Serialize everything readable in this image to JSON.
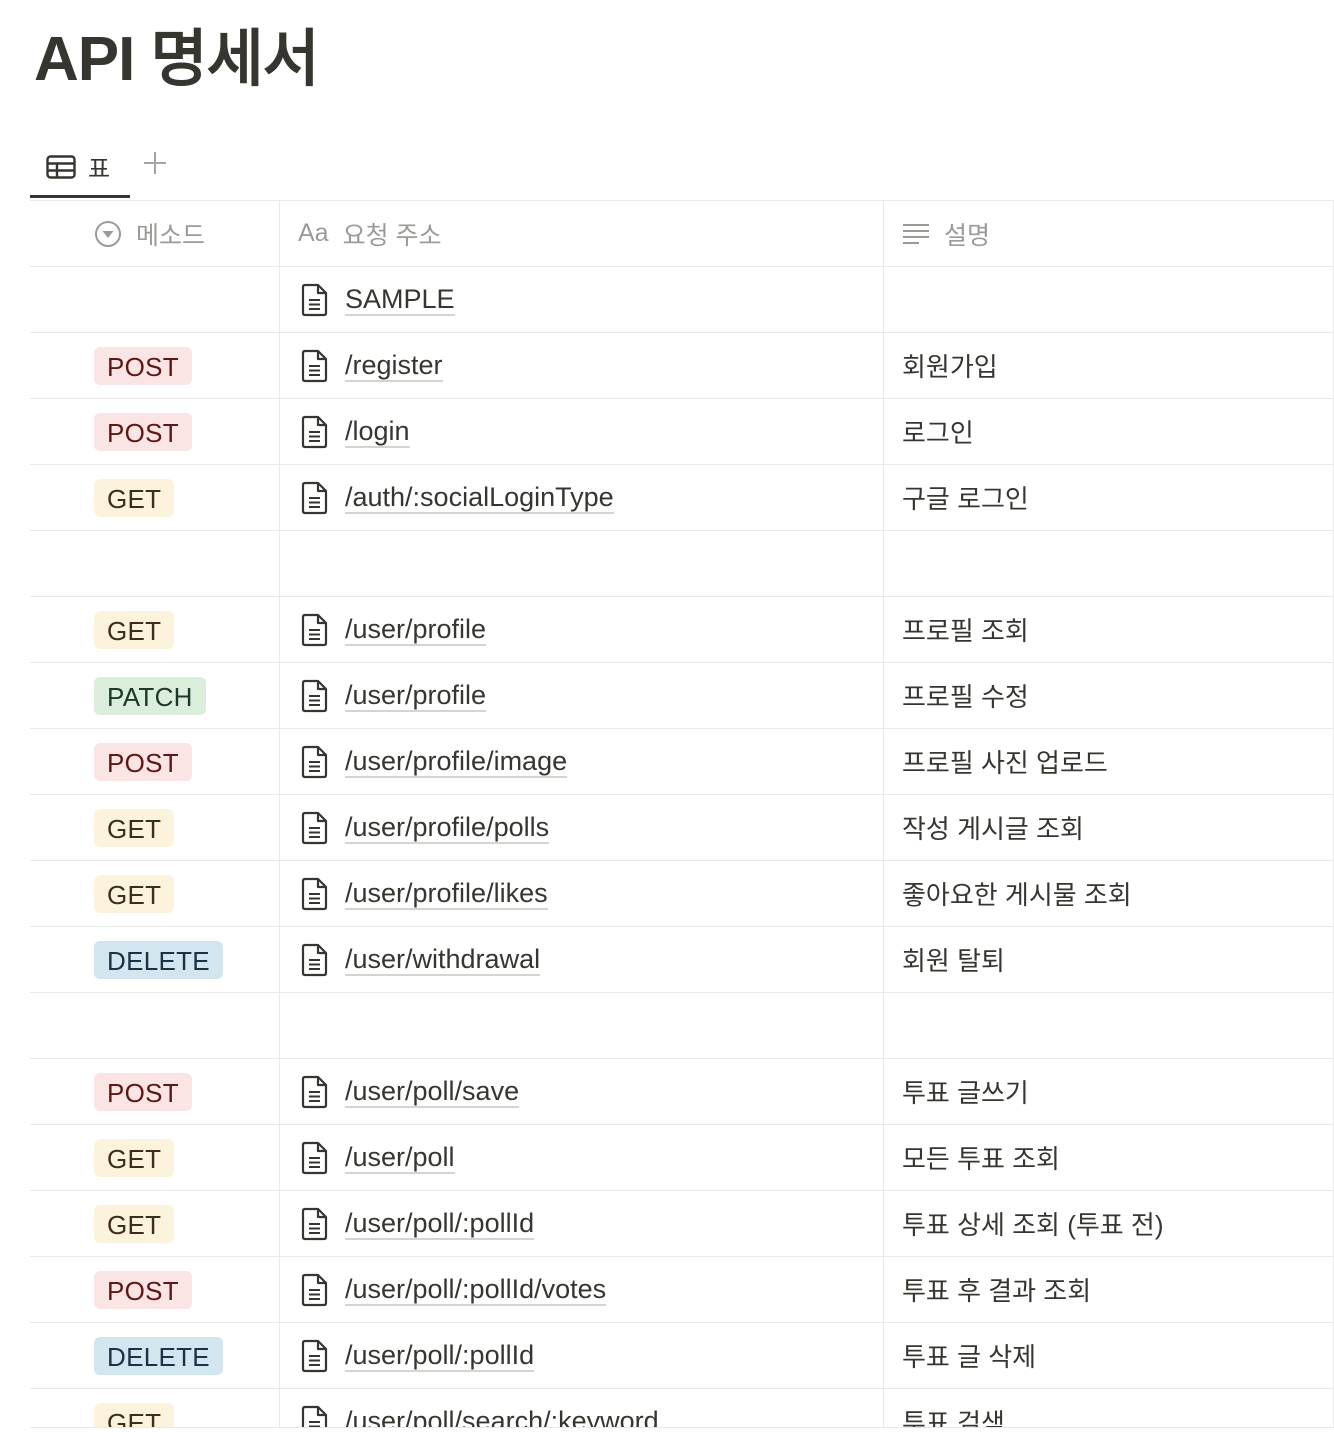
{
  "page": {
    "title": "API 명세서"
  },
  "tabs": {
    "view_label": "표",
    "add_icon": "plus-icon",
    "view_icon": "table-icon"
  },
  "colors": {
    "POST": {
      "bg": "#fbe4e4",
      "fg": "#5d1715"
    },
    "GET": {
      "bg": "#fbf3db",
      "fg": "#402c1b"
    },
    "PATCH": {
      "bg": "#dbeddb",
      "fg": "#1c3829"
    },
    "DELETE": {
      "bg": "#d3e5ef",
      "fg": "#183347"
    }
  },
  "table": {
    "columns": [
      {
        "label": "메소드",
        "icon": "select-property-icon"
      },
      {
        "label": "요청 주소",
        "icon": "title-property-icon",
        "icon_text": "Aa"
      },
      {
        "label": "설명",
        "icon": "text-property-icon"
      }
    ],
    "rows": [
      {
        "method": "",
        "path": "SAMPLE",
        "desc": ""
      },
      {
        "method": "POST",
        "path": "/register",
        "desc": "회원가입"
      },
      {
        "method": "POST",
        "path": "/login",
        "desc": "로그인"
      },
      {
        "method": "GET",
        "path": "/auth/:socialLoginType",
        "desc": "구글 로그인"
      },
      {
        "method": "",
        "path": "",
        "desc": ""
      },
      {
        "method": "GET",
        "path": "/user/profile",
        "desc": "프로필 조회"
      },
      {
        "method": "PATCH",
        "path": "/user/profile",
        "desc": "프로필 수정"
      },
      {
        "method": "POST",
        "path": "/user/profile/image",
        "desc": "프로필 사진 업로드"
      },
      {
        "method": "GET",
        "path": "/user/profile/polls",
        "desc": "작성 게시글 조회"
      },
      {
        "method": "GET",
        "path": "/user/profile/likes",
        "desc": "좋아요한 게시물 조회"
      },
      {
        "method": "DELETE",
        "path": "/user/withdrawal",
        "desc": "회원 탈퇴"
      },
      {
        "method": "",
        "path": "",
        "desc": ""
      },
      {
        "method": "POST",
        "path": "/user/poll/save",
        "desc": "투표 글쓰기"
      },
      {
        "method": "GET",
        "path": "/user/poll",
        "desc": "모든 투표 조회"
      },
      {
        "method": "GET",
        "path": "/user/poll/:pollId",
        "desc": "투표 상세 조회 (투표 전)"
      },
      {
        "method": "POST",
        "path": "/user/poll/:pollId/votes",
        "desc": "투표 후 결과 조회"
      },
      {
        "method": "DELETE",
        "path": "/user/poll/:pollId",
        "desc": "투표 글 삭제"
      },
      {
        "method": "GET",
        "path": "/user/poll/search/:keyword",
        "desc": "투표 검색"
      }
    ]
  }
}
